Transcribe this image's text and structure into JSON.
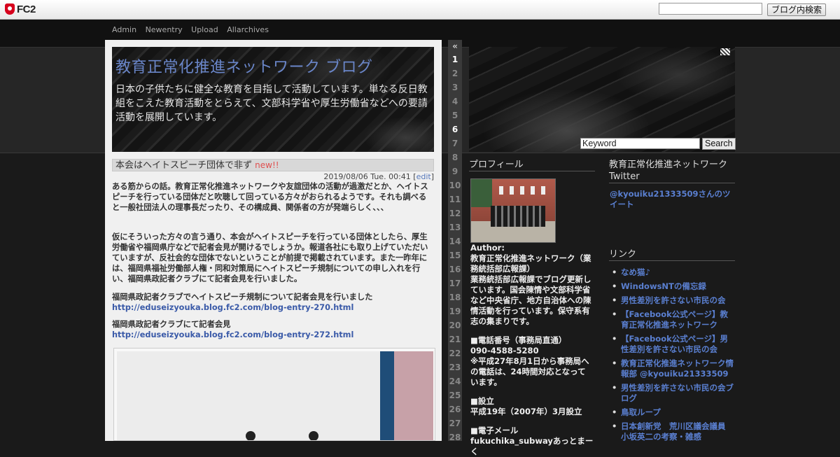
{
  "fc2bar": {
    "logo_text": "FC2",
    "search_button": "ブログ内検索"
  },
  "nav": [
    "Admin",
    "Newentry",
    "Upload",
    "Allarchives"
  ],
  "blog": {
    "title": "教育正常化推進ネットワーク ブログ",
    "description": "日本の子供たちに健全な教育を目指して活動しています。単なる反日教組をこえた教育活動をとらえて、文部科学省や厚生労働省などへの要請活動を展開しています。"
  },
  "entry": {
    "title": "本会はヘイトスピーチ団体で非ず",
    "new_label": "new!!",
    "date": "2019/08/06 Tue. 00:41",
    "edit_label": "edit",
    "p1": "ある筋からの話。教育正常化推進ネットワークや友誼団体の活動が過激だとか、ヘイトスピーチを行っている団体だと吹聴して回っている方々がおられるようです。それも調べると一般社団法人の理事長だったり、その構成員、関係者の方が発端らしく、、、",
    "p2": "仮にそういった方々の言う通り、本会がヘイトスピーチを行っている団体としたら、厚生労働省や福岡県庁などで記者会見が開けるでしょうか。報道各社にも取り上げていただいていますが、反社会的な団体でないということが前提で掲載されています。また一昨年には、福岡県福祉労働部人権・同和対策局にヘイトスピーチ規制についての申し入れを行い、福岡県政記者クラブにて記者会見を行いました。",
    "p3": "福岡県政記者クラブでヘイトスピーチ規制について記者会見を行いました",
    "link1": "http://eduseizyouka.blog.fc2.com/blog-entry-270.html",
    "p4": "福岡県政記者クラブにて記者会見",
    "link2": "http://eduseizyouka.blog.fc2.com/blog-entry-272.html"
  },
  "pager": {
    "prev": "«",
    "numbers": [
      "1",
      "2",
      "3",
      "4",
      "5",
      "6",
      "7",
      "8",
      "9",
      "10",
      "11",
      "12",
      "13",
      "14",
      "15",
      "16",
      "17",
      "18",
      "19",
      "20",
      "21",
      "22",
      "23",
      "24",
      "25",
      "26",
      "27",
      "28"
    ]
  },
  "search": {
    "keyword_value": "Keyword",
    "button": "Search"
  },
  "profile": {
    "title": "プロフィール",
    "author_label": "Author:",
    "name": "教育正常化推進ネットワーク（業務統括部広報課）",
    "bio": "業務統括部広報課でブログ更新しています。国会陳情や文部科学省など中央省庁、地方自治体への陳情活動を行っています。保守系有志の集まりです。",
    "phone_label": "■電話番号（事務局直通）",
    "phone": "090-4588-5280",
    "phone_note": "※平成27年8月1日から事務局への電話は、24時間対応となっています。",
    "founded_label": "■設立",
    "founded": "平成19年（2007年）3月設立",
    "email_label": "■電子メール",
    "email": "fukuchika_subwayあっとまーく"
  },
  "twitter": {
    "title": "教育正常化推進ネットワークTwitter",
    "link": "@kyouiku21333509さんのツイート"
  },
  "links": {
    "title": "リンク",
    "items": [
      "なめ猫♪",
      "WindowsNTの備忘録",
      "男性差別を許さない市民の会",
      "【Facebook公式ページ】教育正常化推進ネットワーク",
      "【Facebook公式ページ】男性差別を許さない市民の会",
      "教育正常化推進ネットワーク情報部 @kyouiku21333509",
      "男性差別を許さない市民の会ブログ",
      "鳥取ループ",
      "日本創新党　荒川区議会議員 小坂英二の考察・雑感"
    ]
  },
  "colors": {
    "link": "#5a7fd0",
    "title_blue": "#6a86c9",
    "new_red": "#e05050"
  }
}
